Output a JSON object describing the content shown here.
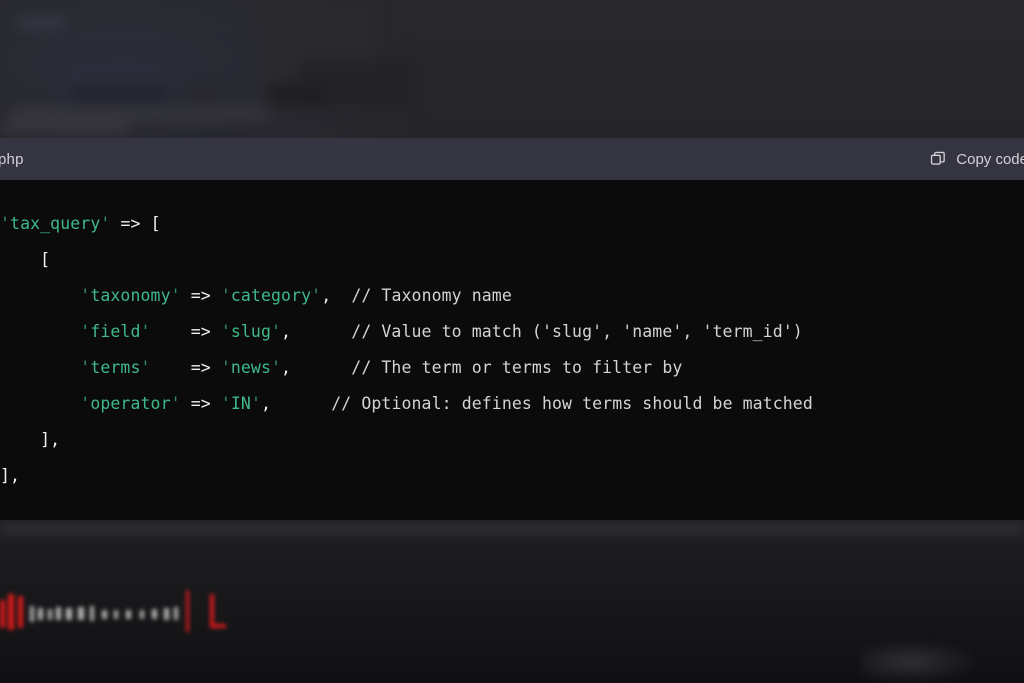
{
  "code_block": {
    "language_label": "php",
    "copy_button_label": "Copy code",
    "copy_icon": "copy-icon",
    "header_bg": "#343541",
    "body_bg": "#0b0b0b",
    "string_color": "#3fb98a",
    "comment_color": "#d4d4d4",
    "punctuation_color": "#f2f2f2",
    "lines": [
      {
        "indent": 0,
        "tokens": [
          {
            "type": "quote",
            "text": "'"
          },
          {
            "type": "string",
            "text": "tax_query"
          },
          {
            "type": "quote",
            "text": "'"
          },
          {
            "type": "plain",
            "text": " "
          },
          {
            "type": "operator",
            "text": "=>"
          },
          {
            "type": "plain",
            "text": " "
          },
          {
            "type": "punct",
            "text": "["
          }
        ]
      },
      {
        "indent": 4,
        "tokens": [
          {
            "type": "punct",
            "text": "["
          }
        ]
      },
      {
        "indent": 8,
        "tokens": [
          {
            "type": "quote",
            "text": "'"
          },
          {
            "type": "string",
            "text": "taxonomy"
          },
          {
            "type": "quote",
            "text": "'"
          },
          {
            "type": "plain",
            "text": " "
          },
          {
            "type": "operator",
            "text": "=>"
          },
          {
            "type": "plain",
            "text": " "
          },
          {
            "type": "quote",
            "text": "'"
          },
          {
            "type": "string",
            "text": "category"
          },
          {
            "type": "quote",
            "text": "'"
          },
          {
            "type": "punct",
            "text": ","
          },
          {
            "type": "plain",
            "text": "  "
          },
          {
            "type": "comment",
            "text": "// Taxonomy name"
          }
        ]
      },
      {
        "indent": 8,
        "tokens": [
          {
            "type": "quote",
            "text": "'"
          },
          {
            "type": "string",
            "text": "field"
          },
          {
            "type": "quote",
            "text": "'"
          },
          {
            "type": "plain",
            "text": "    "
          },
          {
            "type": "operator",
            "text": "=>"
          },
          {
            "type": "plain",
            "text": " "
          },
          {
            "type": "quote",
            "text": "'"
          },
          {
            "type": "string",
            "text": "slug"
          },
          {
            "type": "quote",
            "text": "'"
          },
          {
            "type": "punct",
            "text": ","
          },
          {
            "type": "plain",
            "text": "      "
          },
          {
            "type": "comment",
            "text": "// Value to match ('slug', 'name', 'term_id')"
          }
        ]
      },
      {
        "indent": 8,
        "tokens": [
          {
            "type": "quote",
            "text": "'"
          },
          {
            "type": "string",
            "text": "terms"
          },
          {
            "type": "quote",
            "text": "'"
          },
          {
            "type": "plain",
            "text": "    "
          },
          {
            "type": "operator",
            "text": "=>"
          },
          {
            "type": "plain",
            "text": " "
          },
          {
            "type": "quote",
            "text": "'"
          },
          {
            "type": "string",
            "text": "news"
          },
          {
            "type": "quote",
            "text": "'"
          },
          {
            "type": "punct",
            "text": ","
          },
          {
            "type": "plain",
            "text": "      "
          },
          {
            "type": "comment",
            "text": "// The term or terms to filter by"
          }
        ]
      },
      {
        "indent": 8,
        "tokens": [
          {
            "type": "quote",
            "text": "'"
          },
          {
            "type": "string",
            "text": "operator"
          },
          {
            "type": "quote",
            "text": "'"
          },
          {
            "type": "plain",
            "text": " "
          },
          {
            "type": "operator",
            "text": "=>"
          },
          {
            "type": "plain",
            "text": " "
          },
          {
            "type": "quote",
            "text": "'"
          },
          {
            "type": "string",
            "text": "IN"
          },
          {
            "type": "quote",
            "text": "'"
          },
          {
            "type": "punct",
            "text": ","
          },
          {
            "type": "plain",
            "text": "      "
          },
          {
            "type": "comment",
            "text": "// Optional: defines how terms should be matched"
          }
        ]
      },
      {
        "indent": 4,
        "tokens": [
          {
            "type": "punct",
            "text": "],"
          }
        ]
      },
      {
        "indent": 0,
        "tokens": [
          {
            "type": "punct",
            "text": "],"
          }
        ]
      }
    ]
  },
  "background": {
    "page_bg": "#202023",
    "accent_red": "#d81b1b"
  }
}
